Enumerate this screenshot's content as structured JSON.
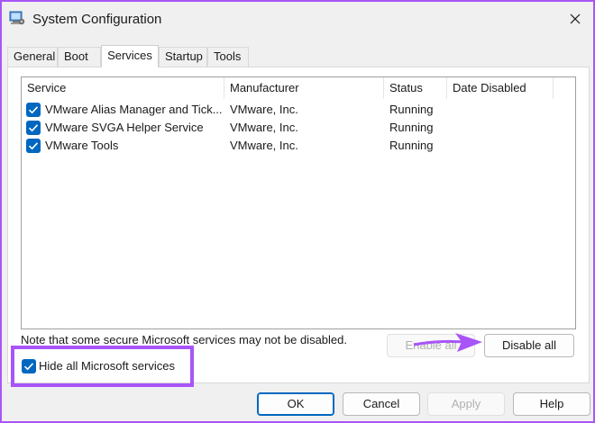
{
  "window": {
    "title": "System Configuration",
    "close_symbol": "✕",
    "accent_color": "#a855f7",
    "checkbox_color": "#0067c0"
  },
  "tabs": [
    {
      "label": "General",
      "active": false
    },
    {
      "label": "Boot",
      "active": false
    },
    {
      "label": "Services",
      "active": true
    },
    {
      "label": "Startup",
      "active": false
    },
    {
      "label": "Tools",
      "active": false
    }
  ],
  "services": {
    "columns": [
      "Service",
      "Manufacturer",
      "Status",
      "Date Disabled"
    ],
    "rows": [
      {
        "checked": true,
        "service": "VMware Alias Manager and Tick...",
        "manufacturer": "VMware, Inc.",
        "status": "Running",
        "date_disabled": ""
      },
      {
        "checked": true,
        "service": "VMware SVGA Helper Service",
        "manufacturer": "VMware, Inc.",
        "status": "Running",
        "date_disabled": ""
      },
      {
        "checked": true,
        "service": "VMware Tools",
        "manufacturer": "VMware, Inc.",
        "status": "Running",
        "date_disabled": ""
      }
    ],
    "note": "Note that some secure Microsoft services may not be disabled.",
    "enable_all_label": "Enable all",
    "disable_all_label": "Disable all",
    "hide_ms_label": "Hide all Microsoft services",
    "hide_ms_checked": true
  },
  "buttons": {
    "ok": "OK",
    "cancel": "Cancel",
    "apply": "Apply",
    "help": "Help"
  }
}
